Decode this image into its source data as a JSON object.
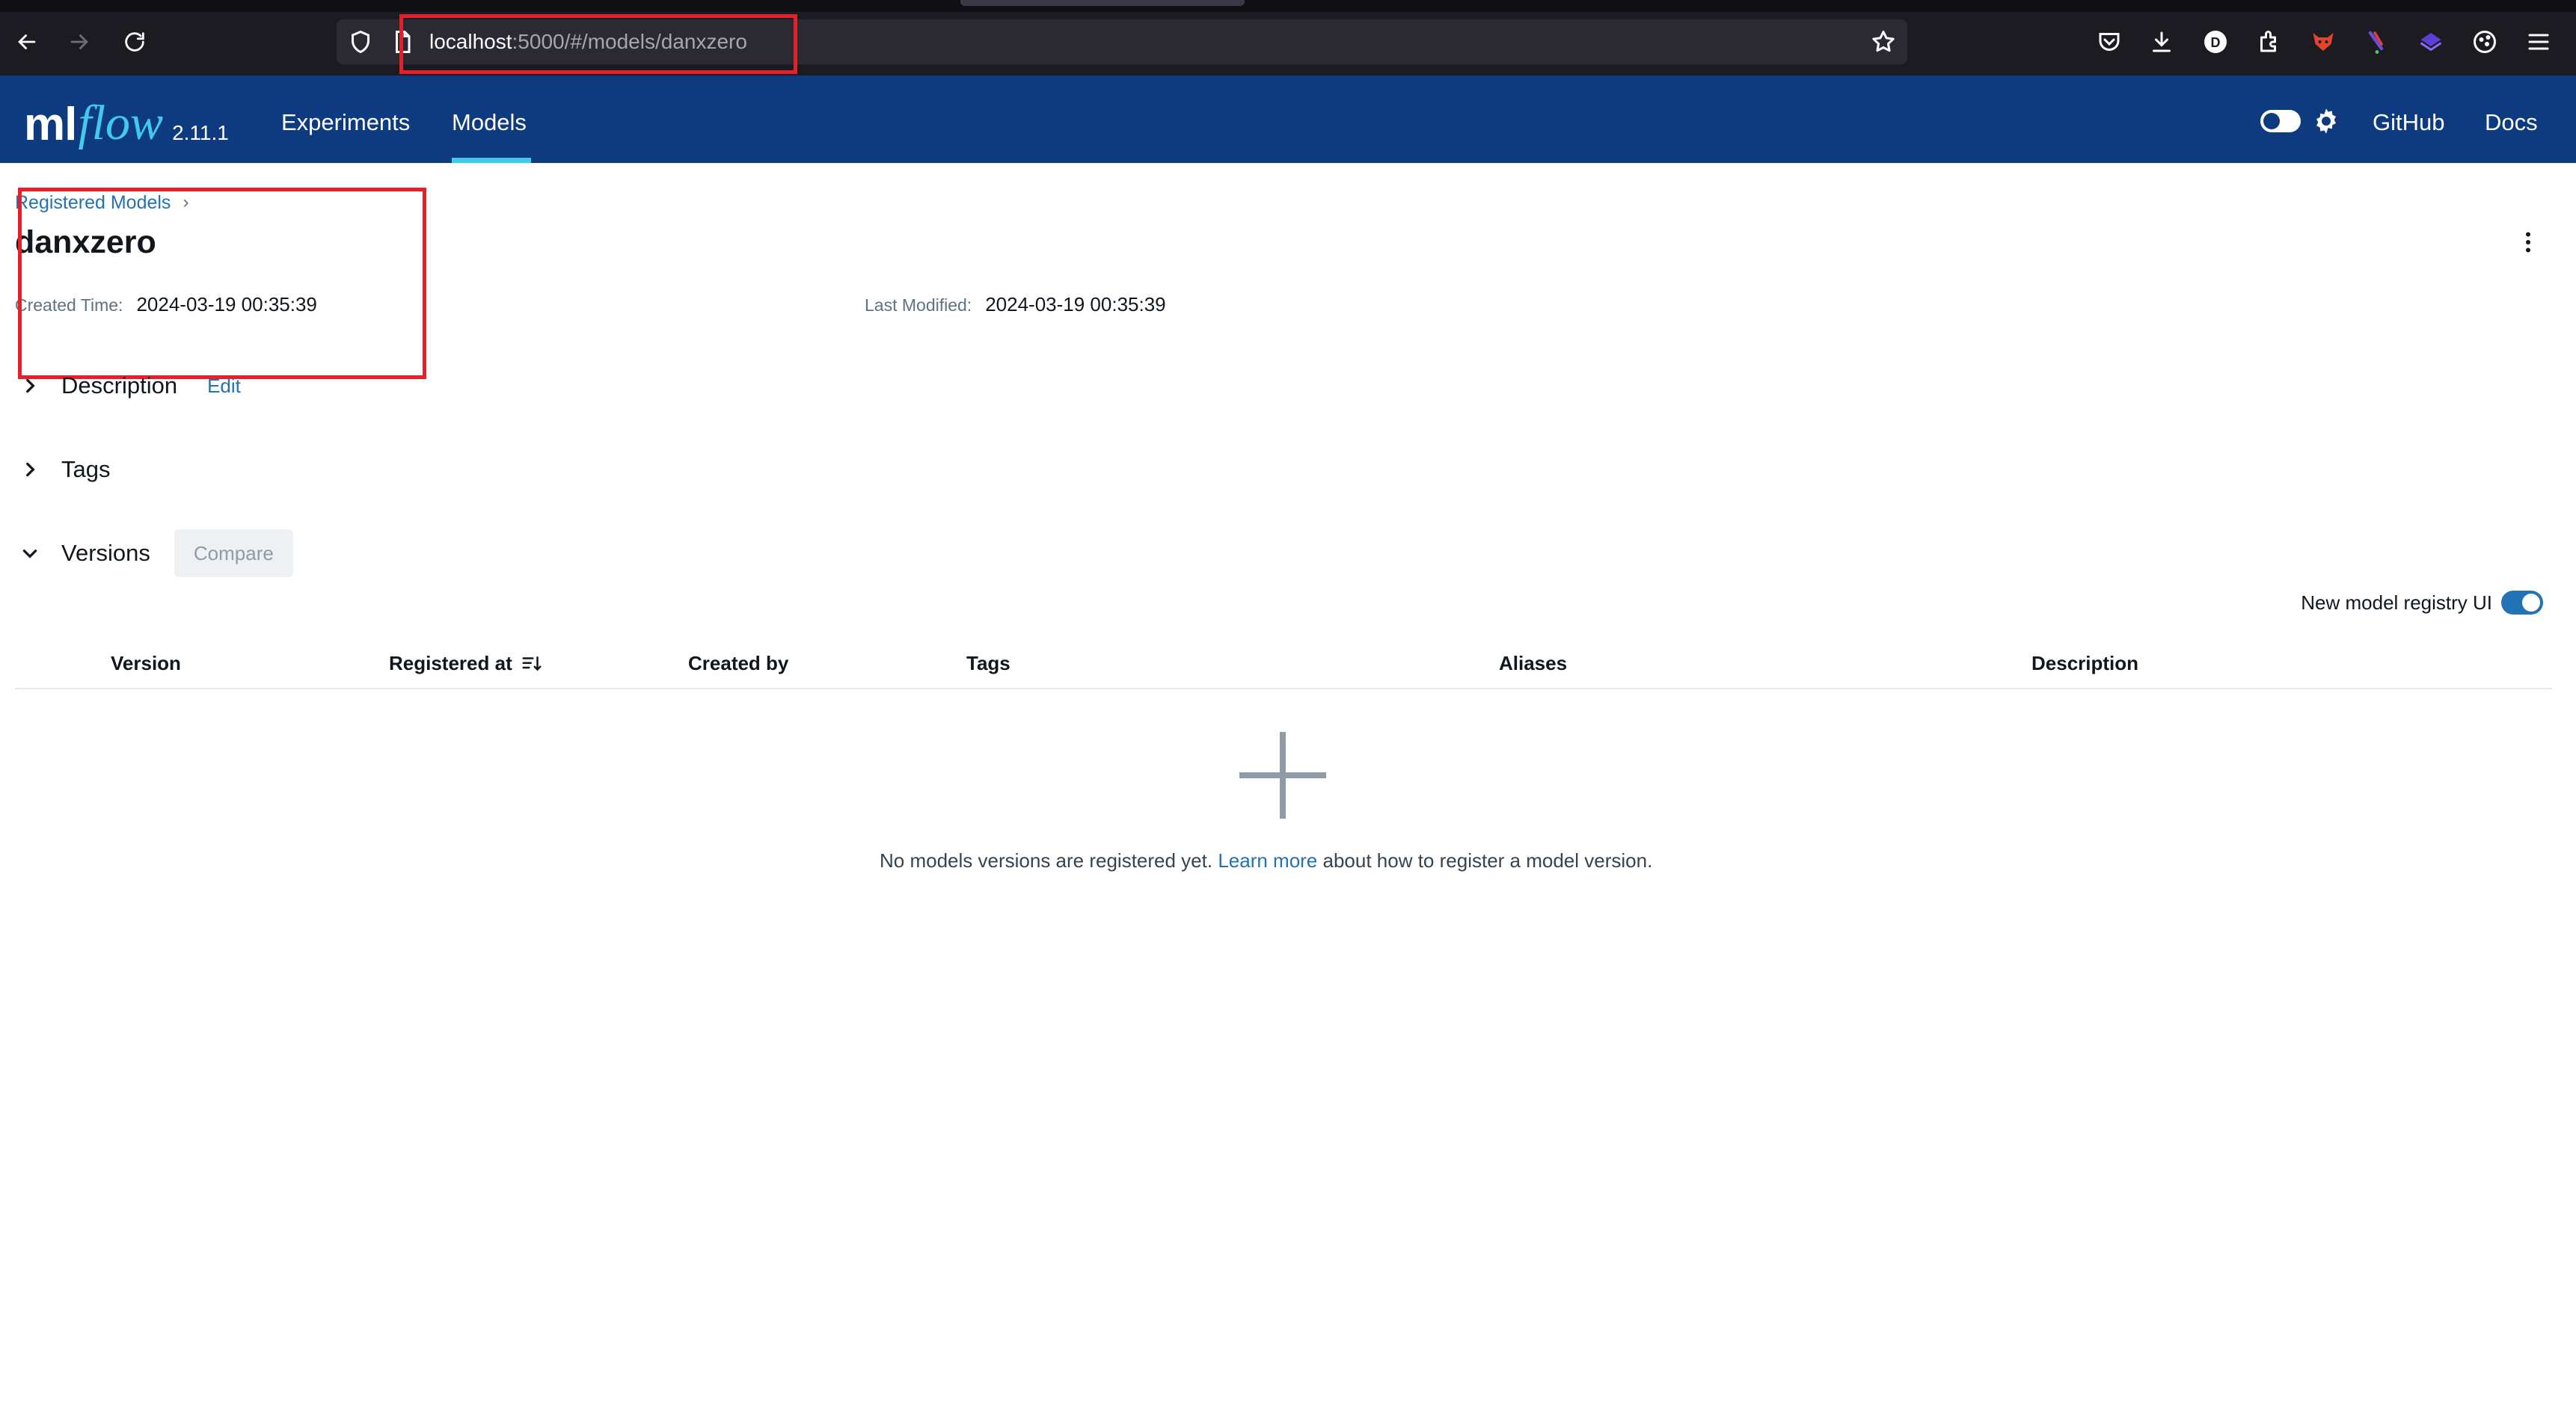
{
  "browser": {
    "url_host": "localhost",
    "url_path": ":5000/#/models/danxzero",
    "profile_initial": "D"
  },
  "header": {
    "logo_ml": "ml",
    "logo_flow": "flow",
    "version": "2.11.1",
    "nav": [
      "Experiments",
      "Models"
    ],
    "active_nav": "Models",
    "links": [
      "GitHub",
      "Docs"
    ]
  },
  "page": {
    "breadcrumb": "Registered Models",
    "breadcrumb_sep": "›",
    "title": "danxzero",
    "created_label": "Created Time:",
    "created_value": "2024-03-19 00:35:39",
    "modified_label": "Last Modified:",
    "modified_value": "2024-03-19 00:35:39"
  },
  "sections": {
    "description": "Description",
    "edit": "Edit",
    "tags": "Tags",
    "versions": "Versions",
    "compare": "Compare"
  },
  "registry_toggle": {
    "label": "New model registry UI",
    "enabled": true
  },
  "table": {
    "columns": [
      "Version",
      "Registered at",
      "Created by",
      "Tags",
      "Aliases",
      "Description"
    ]
  },
  "empty_state": {
    "text_before": "No models versions are registered yet. ",
    "link": "Learn more",
    "text_after": " about how to register a model version."
  },
  "colors": {
    "header_bg": "#0e3b7f",
    "accent": "#43c9ed",
    "link": "#2272b4",
    "annotation_red": "#e5202a"
  }
}
